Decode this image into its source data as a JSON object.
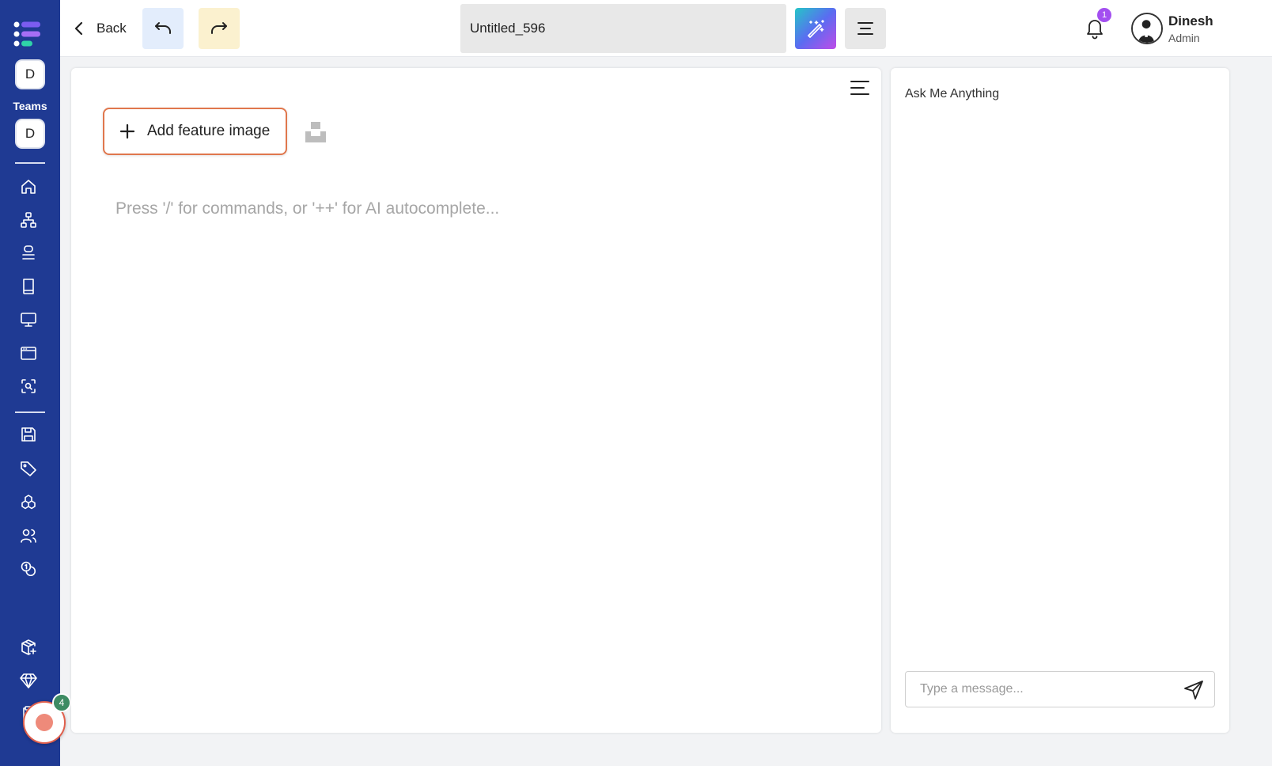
{
  "sidebar": {
    "teams_label": "Teams",
    "team_avatar_top": "D",
    "team_avatar_bottom": "D",
    "nav_icons": [
      "home-icon",
      "sitemap-icon",
      "stack-icon",
      "book-icon",
      "monitor-icon",
      "browser-window-icon",
      "scan-search-icon",
      "save-icon",
      "tag-icon",
      "cubes-icon",
      "users-icon",
      "coins-icon",
      "package-plus-icon",
      "diamond-icon",
      "clipboard-icon"
    ],
    "record_badge_count": "4"
  },
  "header": {
    "back_label": "Back",
    "document_title": "Untitled_596",
    "notification_count": "1",
    "user_name": "Dinesh",
    "user_role": "Admin"
  },
  "editor": {
    "add_feature_image_label": "Add feature image",
    "placeholder": "Press '/' for commands, or '++' for AI autocomplete..."
  },
  "chat": {
    "title": "Ask Me Anything",
    "input_placeholder": "Type a message..."
  },
  "colors": {
    "sidebar_bg": "#1f3a93",
    "accent_orange": "#e0774d",
    "badge_purple": "#a34ff0",
    "badge_green": "#3d8b63"
  }
}
